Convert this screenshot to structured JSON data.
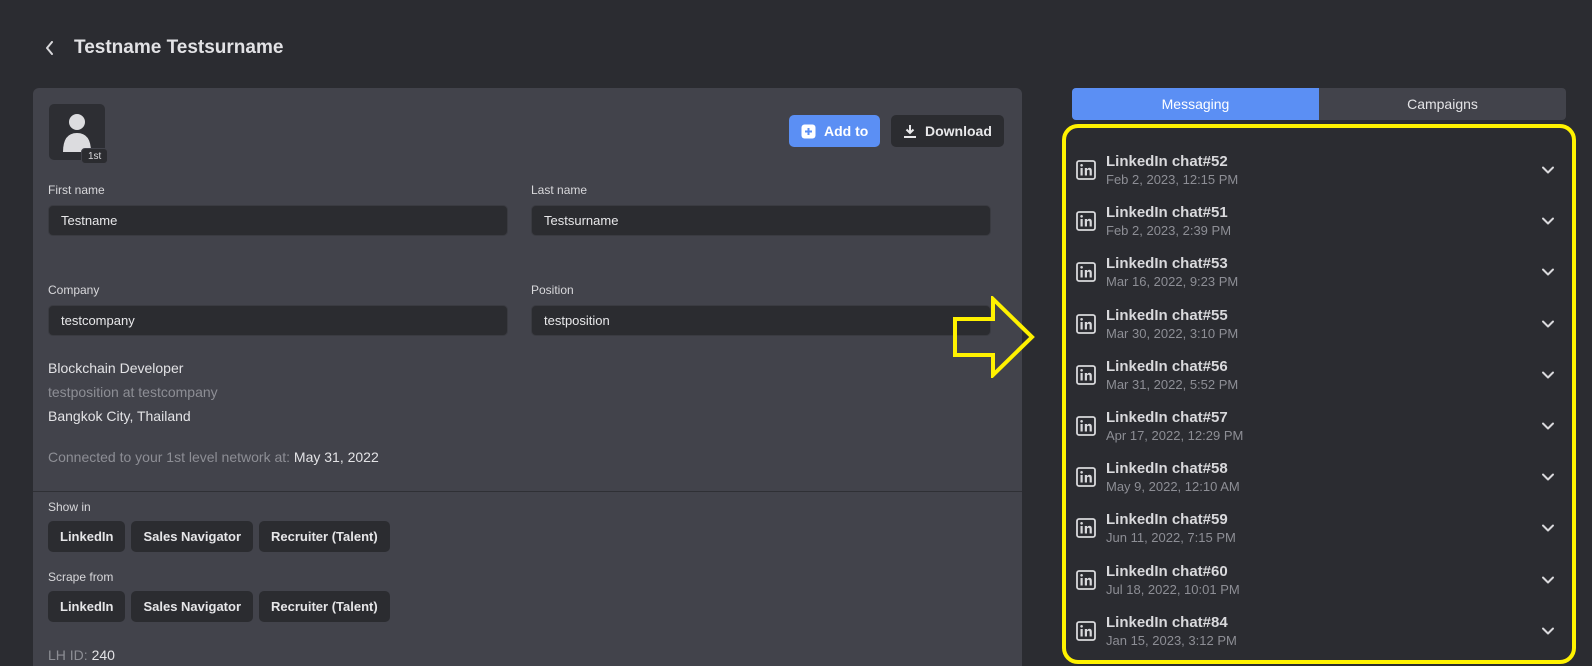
{
  "header": {
    "title": "Testname Testsurname"
  },
  "profile": {
    "degree": "1st",
    "add_label": "Add to",
    "download_label": "Download",
    "fields": {
      "first_name": {
        "label": "First name",
        "value": "Testname"
      },
      "last_name": {
        "label": "Last name",
        "value": "Testsurname"
      },
      "company": {
        "label": "Company",
        "value": "testcompany"
      },
      "position": {
        "label": "Position",
        "value": "testposition"
      }
    },
    "headline": "Blockchain Developer",
    "subtitle": "testposition at testcompany",
    "location": "Bangkok City, Thailand",
    "connected_label": "Connected to your 1st level network at:",
    "connected_date": "May 31, 2022",
    "show_in": {
      "label": "Show in",
      "chips": [
        "LinkedIn",
        "Sales Navigator",
        "Recruiter (Talent)"
      ]
    },
    "scrape_from": {
      "label": "Scrape from",
      "chips": [
        "LinkedIn",
        "Sales Navigator",
        "Recruiter (Talent)"
      ]
    },
    "lh_id_label": "LH ID:",
    "lh_id_value": "240"
  },
  "tabs": [
    {
      "label": "Messaging",
      "active": true
    },
    {
      "label": "Campaigns",
      "active": false
    }
  ],
  "chats": [
    {
      "name": "LinkedIn chat#52",
      "date": "Feb 2, 2023, 12:15 PM"
    },
    {
      "name": "LinkedIn chat#51",
      "date": "Feb 2, 2023, 2:39 PM"
    },
    {
      "name": "LinkedIn chat#53",
      "date": "Mar 16, 2022, 9:23 PM"
    },
    {
      "name": "LinkedIn chat#55",
      "date": "Mar 30, 2022, 3:10 PM"
    },
    {
      "name": "LinkedIn chat#56",
      "date": "Mar 31, 2022, 5:52 PM"
    },
    {
      "name": "LinkedIn chat#57",
      "date": "Apr 17, 2022, 12:29 PM"
    },
    {
      "name": "LinkedIn chat#58",
      "date": "May 9, 2022, 12:10 AM"
    },
    {
      "name": "LinkedIn chat#59",
      "date": "Jun 11, 2022, 7:15 PM"
    },
    {
      "name": "LinkedIn chat#60",
      "date": "Jul 18, 2022, 10:01 PM"
    },
    {
      "name": "LinkedIn chat#84",
      "date": "Jan 15, 2023, 3:12 PM"
    }
  ],
  "colors": {
    "accent": "#5b8ff4",
    "highlight": "#fff200",
    "background": "#2b2c31",
    "card": "#42434b"
  },
  "icons": {
    "back": "chevron-left-icon",
    "add": "plus-square-icon",
    "download": "download-icon",
    "chat": "linkedin-icon",
    "expand": "chevron-down-icon"
  }
}
